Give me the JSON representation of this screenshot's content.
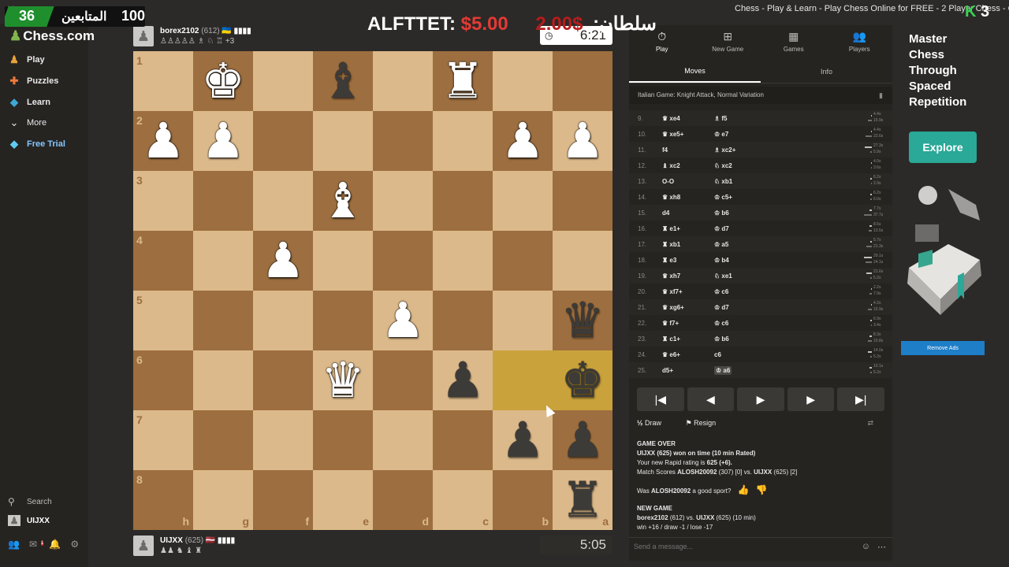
{
  "window": {
    "title": "Chess - Play & Learn - Play Chess Online for FREE - 2 Player Chess - Chess.com"
  },
  "overlay": {
    "followers_label": "المتابعين",
    "followers_num_left": "36",
    "followers_num_right": "100",
    "banner_name": "ALFTTET:",
    "banner_amount": "$5.00",
    "banner_amount2": "2.00$",
    "banner_name2": ":سلطان",
    "k_badge": "3"
  },
  "sidenav": {
    "logo": "Chess.com",
    "items": [
      {
        "label": "Play",
        "icon": "play-icon"
      },
      {
        "label": "Puzzles",
        "icon": "puzzle-icon"
      },
      {
        "label": "Learn",
        "icon": "learn-icon"
      },
      {
        "label": "More",
        "icon": "chevron-down-icon"
      },
      {
        "label": "Free Trial",
        "icon": "diamond-icon"
      }
    ],
    "search": "Search",
    "user": "UIJXX"
  },
  "top_player": {
    "name": "borex2102",
    "rating": "(612)",
    "flag": "🇺🇦 ▮▮▮▮",
    "captured": "♙♙♙♙♙ ♗ ♘ ♖ +3",
    "clock": "6:21"
  },
  "bottom_player": {
    "name": "UIJXX",
    "rating": "(625)",
    "flag": "🇱🇻 ▮▮▮▮",
    "captured": "♟♟ ♞ ♝ ♜",
    "clock": "5:05"
  },
  "board": {
    "ranks": [
      "1",
      "2",
      "3",
      "4",
      "5",
      "6",
      "7",
      "8"
    ],
    "files": [
      "h",
      "g",
      "f",
      "e",
      "d",
      "c",
      "b",
      "a"
    ],
    "pieces": [
      [
        "",
        "wK",
        "",
        "bB",
        "",
        "wR",
        "",
        ""
      ],
      [
        "wP",
        "wP",
        "",
        "",
        "",
        "",
        "wP",
        "wP"
      ],
      [
        "",
        "",
        "",
        "wB",
        "",
        "",
        "",
        ""
      ],
      [
        "",
        "",
        "wP",
        "",
        "",
        "",
        "",
        ""
      ],
      [
        "",
        "",
        "",
        "",
        "wP",
        "",
        "",
        "bQ"
      ],
      [
        "",
        "",
        "",
        "wQ",
        "",
        "bP",
        "HL",
        "bK"
      ],
      [
        "",
        "",
        "",
        "",
        "",
        "",
        "bP",
        "bP"
      ],
      [
        "",
        "",
        "",
        "",
        "",
        "",
        "",
        "bR"
      ]
    ]
  },
  "panel": {
    "tabs": [
      {
        "label": "Play",
        "icon": "stopwatch-icon"
      },
      {
        "label": "New Game",
        "icon": "plus-icon"
      },
      {
        "label": "Games",
        "icon": "board-icon"
      },
      {
        "label": "Players",
        "icon": "players-icon"
      }
    ],
    "subtabs": [
      "Moves",
      "Info"
    ],
    "opening": "Italian Game: Knight Attack, Normal Variation",
    "moves": [
      {
        "n": "9.",
        "w": "♛ xe4",
        "b": "♗ f5",
        "wt": "4.4s",
        "bt": "15.9s"
      },
      {
        "n": "10.",
        "w": "♛ xe5+",
        "b": "♔ e7",
        "wt": "4.4s",
        "bt": "22.6s"
      },
      {
        "n": "11.",
        "w": "f4",
        "b": "♗ xc2+",
        "wt": "27.3s",
        "bt": "5.9s"
      },
      {
        "n": "12.",
        "w": "♝ xc2",
        "b": "♘ xc2",
        "wt": "4.0s",
        "bt": "3.6s"
      },
      {
        "n": "13.",
        "w": "O-O",
        "b": "♘ xb1",
        "wt": "6.2s",
        "bt": "2.9s"
      },
      {
        "n": "14.",
        "w": "♛ xh8",
        "b": "♔ c5+",
        "wt": "6.2s",
        "bt": "6.0s"
      },
      {
        "n": "15.",
        "w": "d4",
        "b": "♔ b6",
        "wt": "7.7s",
        "bt": "37.7s"
      },
      {
        "n": "16.",
        "w": "♜ e1+",
        "b": "♔ d7",
        "wt": "8.5s",
        "bt": "13.5s"
      },
      {
        "n": "17.",
        "w": "♜ xb1",
        "b": "♔ a5",
        "wt": "5.7s",
        "bt": "21.3s"
      },
      {
        "n": "18.",
        "w": "♜ e3",
        "b": "♔ b4",
        "wt": "29.1s",
        "bt": "24.1s"
      },
      {
        "n": "19.",
        "w": "♛ xh7",
        "b": "♘ xe1",
        "wt": "21.6s",
        "bt": "5.2s"
      },
      {
        "n": "20.",
        "w": "♛ xf7+",
        "b": "♔ c6",
        "wt": "2.2s",
        "bt": "7.9s"
      },
      {
        "n": "21.",
        "w": "♛ xg6+",
        "b": "♔ d7",
        "wt": "4.2s",
        "bt": "15.9s"
      },
      {
        "n": "22.",
        "w": "♛ f7+",
        "b": "♔ c6",
        "wt": "6.9s",
        "bt": "3.4s"
      },
      {
        "n": "23.",
        "w": "♜ c1+",
        "b": "♔ b6",
        "wt": "8.3s",
        "bt": "15.8s"
      },
      {
        "n": "24.",
        "w": "♛ e6+",
        "b": "c6",
        "wt": "14.0s",
        "bt": "5.2s"
      },
      {
        "n": "25.",
        "w": "d5+",
        "b": "♔ a6",
        "wt": "10.1s",
        "bt": "5.2s"
      }
    ],
    "actions": {
      "draw": "Draw",
      "resign": "Resign",
      "draw_icon": "½"
    },
    "chat": {
      "game_over": "GAME OVER",
      "line1": "UIJXX (625) won on time (10 min Rated)",
      "line2_pre": "Your new Rapid rating is ",
      "line2_val": "625 (+6).",
      "line3_pre": "Match Scores ",
      "line3_a": "ALOSH20092",
      "line3_mid": " (307) [0] vs. ",
      "line3_b": "UIJXX",
      "line3_end": " (625) [2]",
      "sport_pre": "Was ",
      "sport_name": "ALOSH20092",
      "sport_post": " a good sport?",
      "new_game": "NEW GAME",
      "ng_a": "borex2102",
      "ng_mid": " (612) vs. ",
      "ng_b": "UIJXX",
      "ng_end": " (625) (10 min)",
      "stakes": "win +16 / draw -1 / lose -17"
    },
    "message_placeholder": "Send a message..."
  },
  "ad": {
    "title": [
      "Master",
      "Chess",
      "Through",
      "Spaced",
      "Repetition"
    ],
    "button": "Explore",
    "remove": "Remove Ads"
  },
  "colors": {
    "light_square": "#dcb98a",
    "dark_square": "#9d6e3f",
    "highlight": "#caa23c",
    "accent": "#81b64c"
  }
}
